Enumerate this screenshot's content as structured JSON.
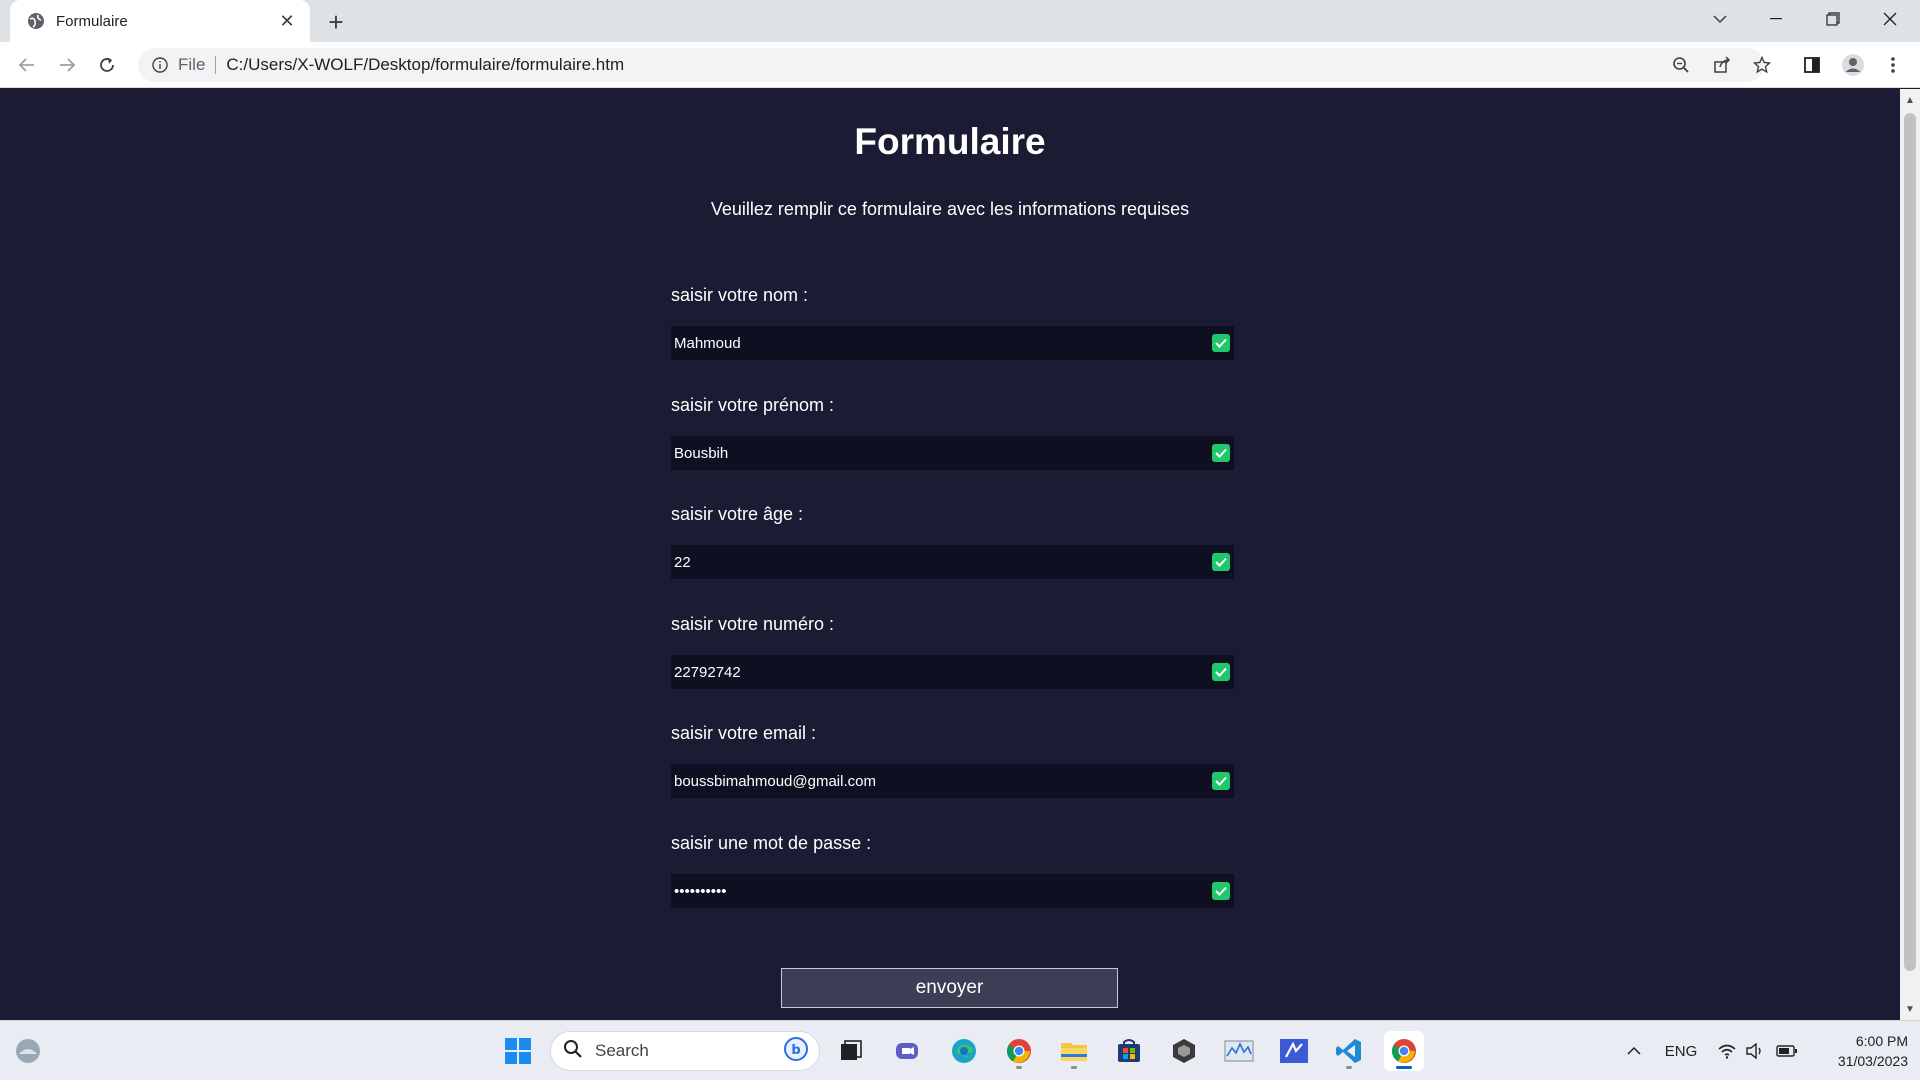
{
  "browser": {
    "tab": {
      "title": "Formulaire"
    },
    "address": {
      "scheme": "File",
      "url": "C:/Users/X-WOLF/Desktop/formulaire/formulaire.htm"
    }
  },
  "page": {
    "title": "Formulaire",
    "subtitle": "Veuillez remplir ce formulaire avec les informations requises",
    "fields": [
      {
        "label": "saisir votre nom :",
        "value": "Mahmoud",
        "valid": true
      },
      {
        "label": "saisir votre prénom :",
        "value": "Bousbih",
        "valid": true
      },
      {
        "label": "saisir votre âge :",
        "value": "22",
        "valid": true
      },
      {
        "label": "saisir votre numéro :",
        "value": "22792742",
        "valid": true
      },
      {
        "label": "saisir votre email :",
        "value": "boussbimahmoud@gmail.com",
        "valid": true
      },
      {
        "label": "saisir une mot de passe :",
        "value": "••••••••••",
        "valid": true
      }
    ],
    "submit_label": "envoyer"
  },
  "taskbar": {
    "search_placeholder": "Search",
    "language": "ENG",
    "time": "6:00 PM",
    "date": "31/03/2023",
    "apps": [
      "start-icon",
      "file-explorer-icon",
      "teams-icon",
      "edge-icon",
      "chrome-icon",
      "folder-icon",
      "store-icon",
      "unity-icon",
      "monitor-icon",
      "mathpad-icon",
      "vscode-icon",
      "chrome-active-icon"
    ]
  },
  "colors": {
    "page_bg": "#1b1c33",
    "field_bg": "#0f0f22",
    "check_green": "#1fc86c",
    "button_bg": "#3d3e55"
  }
}
